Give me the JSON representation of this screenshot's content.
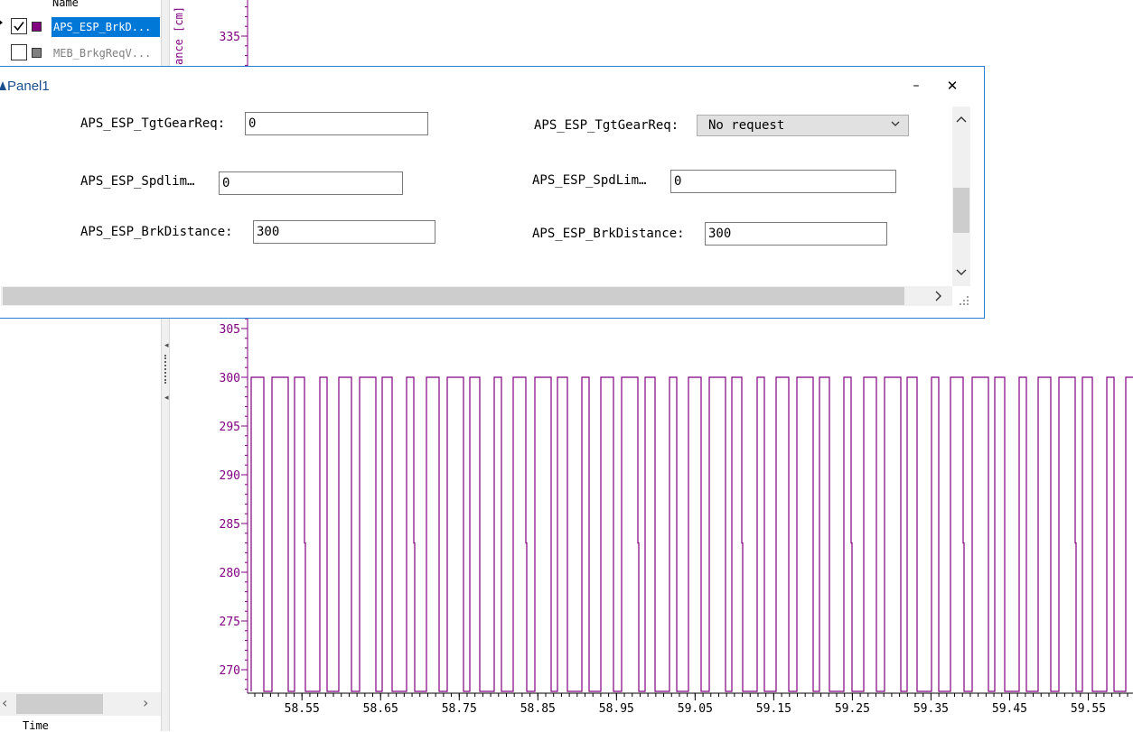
{
  "signal_list": {
    "column_header": "Name",
    "rows": [
      {
        "name": "APS_ESP_BrkD...",
        "checked": true,
        "color": "#800080",
        "selected": true
      },
      {
        "name": "MEB_BrkgReqV...",
        "checked": false,
        "color": "#808080",
        "selected": false
      }
    ],
    "footer_label": "Time"
  },
  "panel": {
    "title": "Panel1",
    "minimize_glyph": "–",
    "close_glyph": "✕",
    "fields": {
      "tgt_gear_left_label": "APS_ESP_TgtGearReq:",
      "tgt_gear_left_value": "0",
      "tgt_gear_right_label": "APS_ESP_TgtGearReq:",
      "tgt_gear_right_selected": "No request",
      "spdlim_left_label": "APS_ESP_Spdlim…",
      "spdlim_left_value": "0",
      "spdlim_right_label": "APS_ESP_SpdLim…",
      "spdlim_right_value": "0",
      "brk_left_label": "APS_ESP_BrkDistance:",
      "brk_left_value": "300",
      "brk_right_label": "APS_ESP_BrkDistance:",
      "brk_right_value": "300"
    }
  },
  "chart_data": {
    "type": "line",
    "ylabel_partial": "ance [cm]",
    "signal_color": "#800080",
    "y_ticks": [
      335,
      305,
      300,
      295,
      290,
      285,
      280,
      275,
      270
    ],
    "x_ticks": [
      "58.55",
      "58.65",
      "58.75",
      "58.85",
      "58.95",
      "59.05",
      "59.15",
      "59.25",
      "59.35",
      "59.45",
      "59.55"
    ],
    "high": 300,
    "spike": 283,
    "low_clip": 268,
    "x_range": [
      58.49,
      59.6
    ]
  }
}
